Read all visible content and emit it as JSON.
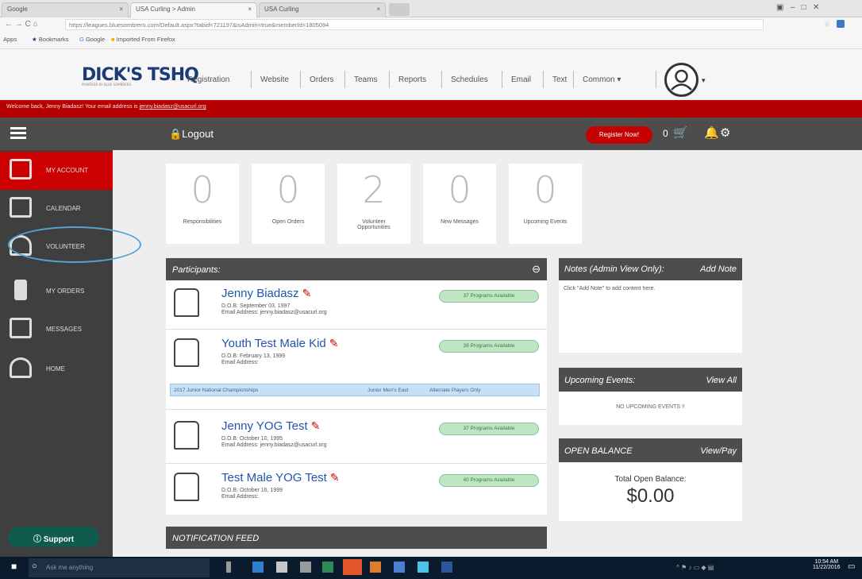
{
  "browser": {
    "tabs": [
      {
        "label": "Google"
      },
      {
        "label": "USA Curling > Admin"
      },
      {
        "label": "USA Curling"
      }
    ],
    "url": "https://leagues.bluesombrero.com/Default.aspx?tabid=721197&isAdmin=true&memberId=1805094",
    "bookmarks": [
      "Apps",
      "Bookmarks",
      "Google",
      "Imported From Firefox"
    ]
  },
  "site": {
    "logo": "DICK'S TSHQ",
    "logo_sub": "POWERED BY BLUE SOMBRERO",
    "nav": [
      "Registration",
      "Website",
      "Orders",
      "Teams",
      "Reports",
      "Schedules",
      "Email",
      "Text",
      "Common"
    ],
    "welcome_prefix": "Welcome back, Jenny Biadasz! Your email address is",
    "welcome_email": "jenny.biadasz@usacurl.org"
  },
  "topbar": {
    "logout": "Logout",
    "register": "Register Now!",
    "cart_count": "0"
  },
  "sidebar": {
    "items": [
      {
        "label": "MY ACCOUNT",
        "icon": "monitor-icon"
      },
      {
        "label": "CALENDAR",
        "icon": "calendar-icon"
      },
      {
        "label": "VOLUNTEER",
        "icon": "volunteer-icon"
      },
      {
        "label": "MY ORDERS",
        "icon": "bottle-icon"
      },
      {
        "label": "MESSAGES",
        "icon": "message-icon"
      },
      {
        "label": "HOME",
        "icon": "home-icon"
      }
    ],
    "support": "Support"
  },
  "stats": [
    {
      "value": "0",
      "label": "Responsibilities"
    },
    {
      "value": "0",
      "label": "Open Orders"
    },
    {
      "value": "2",
      "label": "Volunteer Opportunities"
    },
    {
      "value": "0",
      "label": "New Messages"
    },
    {
      "value": "0",
      "label": "Upcoming Events"
    }
  ],
  "participants": {
    "title": "Participants",
    "rows": [
      {
        "name": "Jenny Biadasz",
        "dob": "D.O.B: September 03, 1997",
        "email": "Email Address: jenny.biadasz@usacurl.org",
        "programs": "37 Programs Available"
      },
      {
        "name": "Youth Test Male Kid",
        "dob": "D.O.B: February 13, 1999",
        "email": "Email Address:",
        "programs": "39 Programs Available"
      },
      {
        "name": "Jenny YOG Test",
        "dob": "D.O.B: October 10, 1995",
        "email": "Email Address: jenny.biadasz@usacurl.org",
        "programs": "37 Programs Available"
      },
      {
        "name": "Test Male YOG Test",
        "dob": "D.O.B: October 16, 1999",
        "email": "Email Address:",
        "programs": "40 Programs Available"
      }
    ],
    "program_strip": {
      "col1": "2017 Junior National Championships",
      "col2": "Junior Men's East",
      "col3": "Alternate Players Only"
    }
  },
  "notification_feed": "NOTIFICATION FEED",
  "notes": {
    "title": "Notes (Admin View Only)",
    "action": "Add Note",
    "body": "Click \"Add Note\" to add content here."
  },
  "upcoming": {
    "title": "Upcoming Events:",
    "action": "View All",
    "body": "NO UPCOMING EVENTS !!"
  },
  "balance": {
    "title": "OPEN BALANCE",
    "action": "View/Pay",
    "label": "Total Open Balance:",
    "amount": "$0.00"
  },
  "taskbar": {
    "search": "Ask me anything",
    "time": "10:54 AM",
    "date": "11/22/2016"
  }
}
